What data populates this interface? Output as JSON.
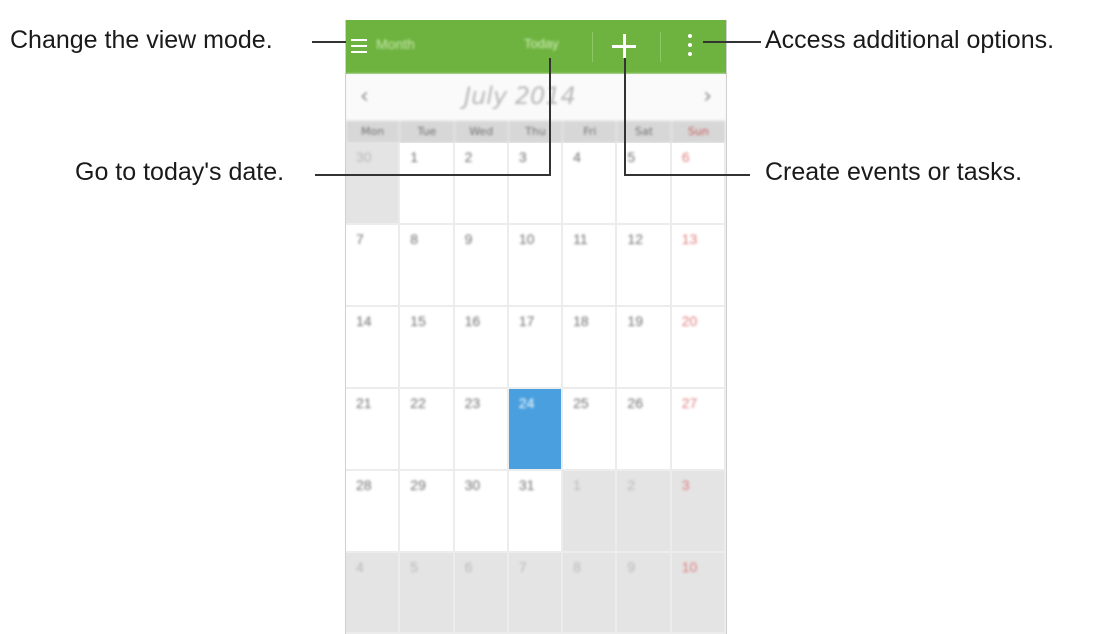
{
  "app": {
    "view_mode_label": "Month",
    "today_label": "Today",
    "month_title": "July 2014",
    "prev_symbol": "‹",
    "next_symbol": "›",
    "weekdays": [
      "Mon",
      "Tue",
      "Wed",
      "Thu",
      "Fri",
      "Sat",
      "Sun"
    ],
    "weeks": [
      [
        "30",
        "1",
        "2",
        "3",
        "4",
        "5",
        "6"
      ],
      [
        "7",
        "8",
        "9",
        "10",
        "11",
        "12",
        "13"
      ],
      [
        "14",
        "15",
        "16",
        "17",
        "18",
        "19",
        "20"
      ],
      [
        "21",
        "22",
        "23",
        "24",
        "25",
        "26",
        "27"
      ],
      [
        "28",
        "29",
        "30",
        "31",
        "1",
        "2",
        "3"
      ],
      [
        "4",
        "5",
        "6",
        "7",
        "8",
        "9",
        "10"
      ]
    ],
    "today_date": "24",
    "accent_color": "#6eb33f",
    "today_color": "#4aa0de",
    "icons": [
      "menu-icon",
      "plus-icon",
      "more-vert-icon",
      "chevron-left-icon",
      "chevron-right-icon"
    ]
  },
  "callouts": {
    "view_mode": "Change the view mode.",
    "today": "Go to today's date.",
    "more_options": "Access additional options.",
    "create": "Create events or tasks."
  }
}
